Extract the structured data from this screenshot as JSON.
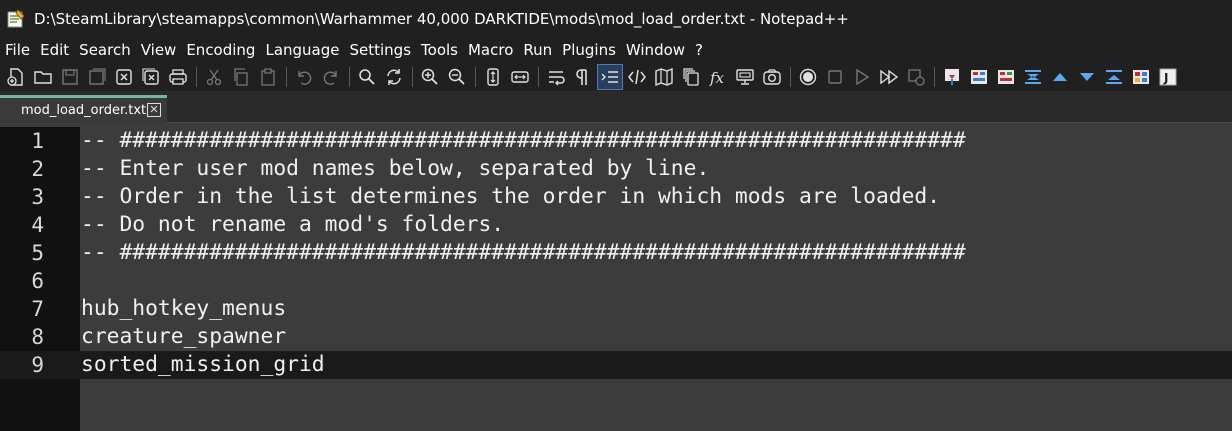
{
  "window": {
    "title": "D:\\SteamLibrary\\steamapps\\common\\Warhammer 40,000 DARKTIDE\\mods\\mod_load_order.txt - Notepad++"
  },
  "menu": {
    "file": "File",
    "edit": "Edit",
    "search": "Search",
    "view": "View",
    "encoding": "Encoding",
    "language": "Language",
    "settings": "Settings",
    "tools": "Tools",
    "macro": "Macro",
    "run": "Run",
    "plugins": "Plugins",
    "window": "Window",
    "help": "?"
  },
  "tab": {
    "label": "mod_load_order.txt",
    "close": "✕"
  },
  "editor": {
    "lines": [
      {
        "num": "1",
        "text": "-- ##################################################################"
      },
      {
        "num": "2",
        "text": "-- Enter user mod names below, separated by line."
      },
      {
        "num": "3",
        "text": "-- Order in the list determines the order in which mods are loaded."
      },
      {
        "num": "4",
        "text": "-- Do not rename a mod's folders."
      },
      {
        "num": "5",
        "text": "-- ##################################################################"
      },
      {
        "num": "6",
        "text": ""
      },
      {
        "num": "7",
        "text": "hub_hotkey_menus"
      },
      {
        "num": "8",
        "text": "creature_spawner"
      },
      {
        "num": "9",
        "text": "sorted_mission_grid"
      }
    ]
  },
  "colors": {
    "background": "#3c3c3c",
    "gutter": "#111111",
    "chrome": "#202020",
    "tab_accent": "#6db7a8"
  }
}
